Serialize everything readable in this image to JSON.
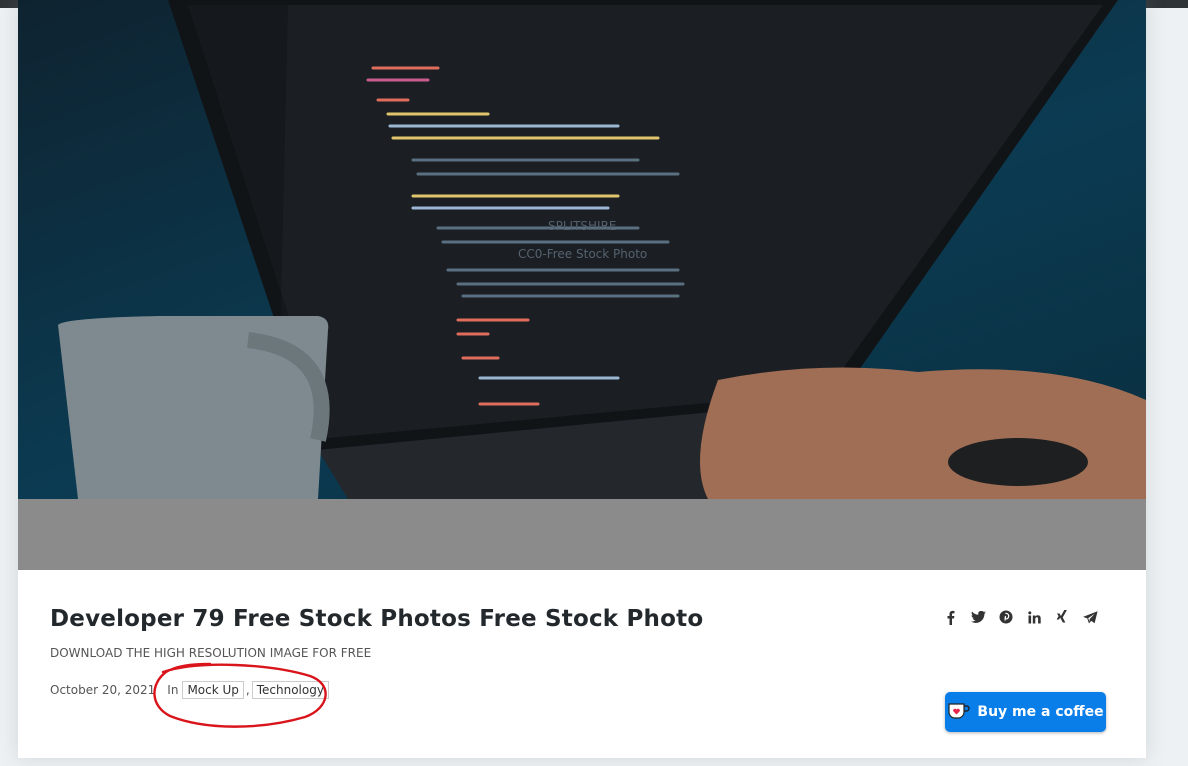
{
  "post": {
    "title": "Developer 79 Free Stock Photos Free Stock Photo",
    "subtitle": "DOWNLOAD THE HIGH RESOLUTION IMAGE FOR FREE",
    "date": "October 20, 2021",
    "in_label": "In",
    "tags": [
      "Mock Up",
      "Technology"
    ]
  },
  "image": {
    "watermark_brand": "SPLITSHIRE",
    "watermark_text": "CC0-Free Stock Photo"
  },
  "share_icons": [
    "facebook-icon",
    "twitter-icon",
    "pinterest-icon",
    "linkedin-icon",
    "xing-icon",
    "telegram-icon"
  ],
  "coffee_button": {
    "label": "Buy me a coffee",
    "color": "#0a7ee8"
  },
  "annotation": {
    "color": "#d9141b"
  }
}
